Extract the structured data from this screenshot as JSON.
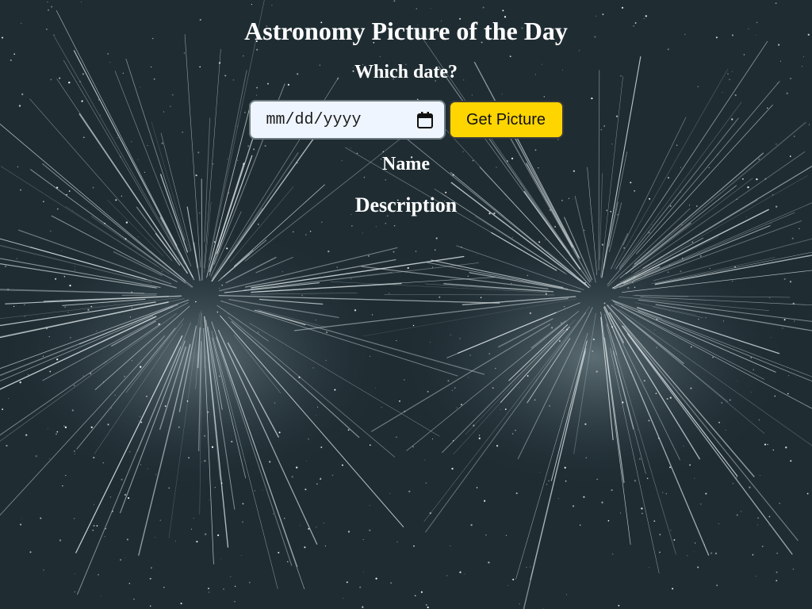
{
  "header": {
    "title": "Astronomy Picture of the Day"
  },
  "form": {
    "prompt": "Which date?",
    "date_placeholder": "mm/dd/yyyy",
    "submit_label": "Get Picture"
  },
  "result": {
    "name_heading": "Name",
    "description_heading": "Description"
  },
  "icons": {
    "date_picker": "calendar-icon"
  },
  "colors": {
    "background": "#1f2d33",
    "button": "#ffd500",
    "date_field": "#eef5ff",
    "text": "#ffffff"
  }
}
